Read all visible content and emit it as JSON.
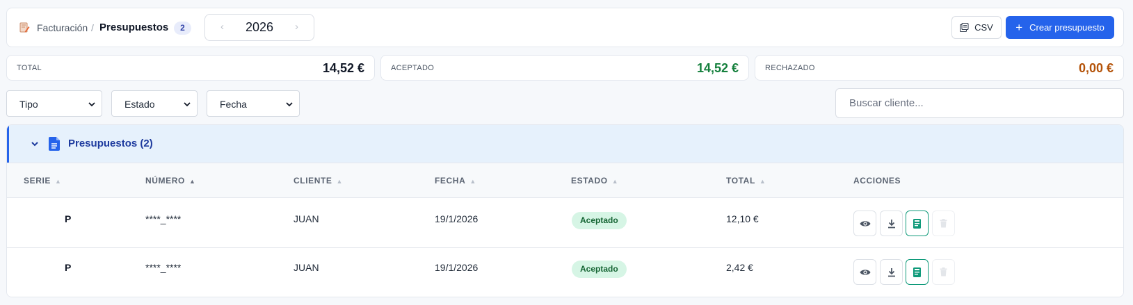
{
  "header": {
    "breadcrumb_parent": "Facturación",
    "breadcrumb_separator": "/",
    "breadcrumb_current": "Presupuestos",
    "count": "2",
    "year": "2026",
    "year_prev": "‹",
    "year_next": "›",
    "csv_label": "CSV",
    "create_label": "Crear presupuesto",
    "create_plus": "+"
  },
  "stats": {
    "total_label": "TOTAL",
    "total_value": "14,52 €",
    "accepted_label": "ACEPTADO",
    "accepted_value": "14,52 €",
    "rejected_label": "RECHAZADO",
    "rejected_value": "0,00 €"
  },
  "filters": {
    "tipo": "Tipo",
    "estado": "Estado",
    "fecha": "Fecha",
    "search_placeholder": "Buscar cliente..."
  },
  "group": {
    "title": "Presupuestos (2)"
  },
  "table": {
    "columns": [
      "SERIE",
      "NÚMERO",
      "CLIENTE",
      "FECHA",
      "ESTADO",
      "TOTAL",
      "ACCIONES"
    ],
    "rows": [
      {
        "serie": "P",
        "numero": "****_****",
        "cliente": "JUAN",
        "fecha": "19/1/2026",
        "estado": "Aceptado",
        "total": "12,10 €"
      },
      {
        "serie": "P",
        "numero": "****_****",
        "cliente": "JUAN",
        "fecha": "19/1/2026",
        "estado": "Aceptado",
        "total": "2,42 €"
      }
    ]
  },
  "icons": {
    "breadcrumb": "edit-document-icon",
    "csv": "spreadsheet-icon",
    "group_toggle": "chevron-down-icon",
    "group": "document-icon",
    "view": "eye-icon",
    "download": "download-icon",
    "invoice": "receipt-icon",
    "delete": "trash-icon"
  },
  "colors": {
    "primary": "#2563eb",
    "total": "#111827",
    "accepted": "#15803d",
    "rejected": "#b45309",
    "status_bg": "#d6f5e5",
    "status_text": "#166534",
    "invoice_border": "#0f9a7a"
  }
}
